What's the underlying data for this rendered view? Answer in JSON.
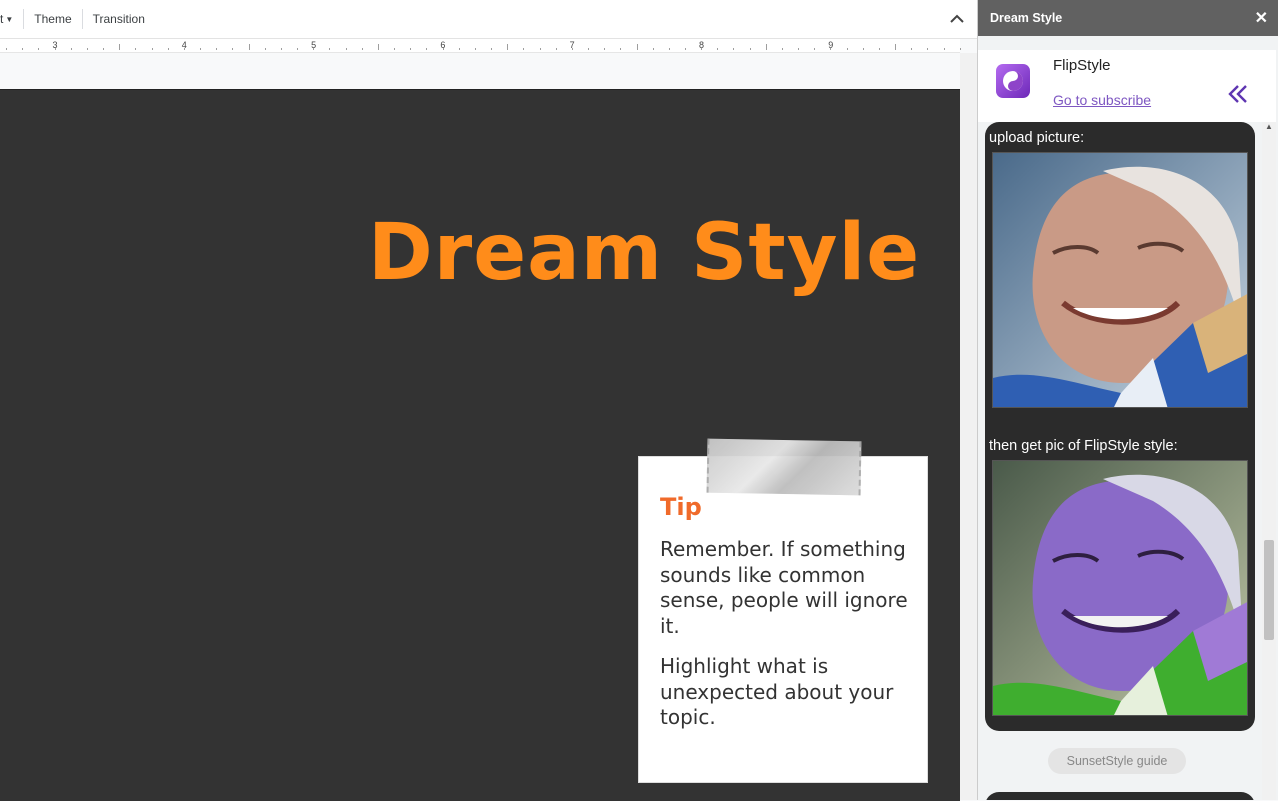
{
  "toolbar": {
    "partial_menu_label": "t",
    "theme_label": "Theme",
    "transition_label": "Transition"
  },
  "ruler": {
    "numbers": [
      "3",
      "4",
      "5",
      "6",
      "7",
      "8",
      "9"
    ]
  },
  "slide": {
    "title": "Dream Style",
    "title_color": "#ff8c1a",
    "background": "#333333",
    "tip": {
      "heading": "Tip",
      "heading_color": "#f06a2a",
      "paragraph1": "Remember. If something sounds like common sense, people will ignore it.",
      "paragraph2": "Highlight what is unexpected about your topic."
    }
  },
  "panel": {
    "title": "Dream Style",
    "brand_name": "FlipStyle",
    "subscribe_label": "Go to subscribe",
    "upload_label": "upload picture:",
    "result_label": "then get pic of FlipStyle style:",
    "guide_button_label": "SunsetStyle guide",
    "accent_color": "#7e57c2"
  },
  "icons": {
    "close": "close-icon",
    "collapse": "chevron-up-icon",
    "expand": "double-chevron-left-icon",
    "logo": "yin-yang-icon"
  }
}
